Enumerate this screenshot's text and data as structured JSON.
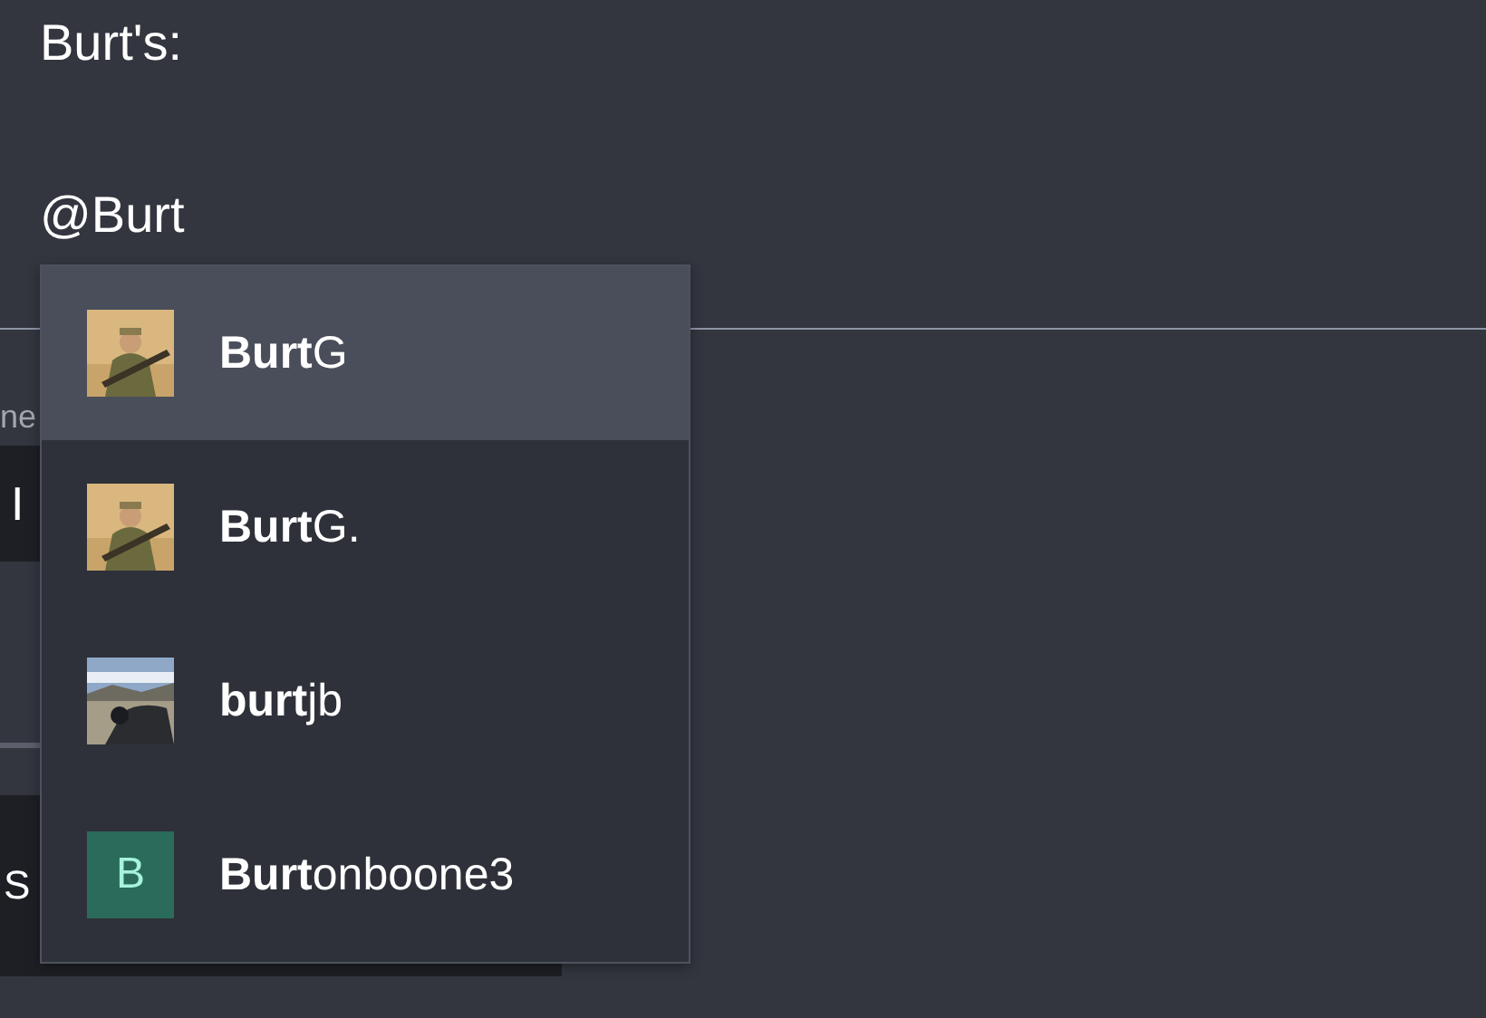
{
  "message": {
    "lines": [
      "Burt's:",
      "@Burt"
    ]
  },
  "background": {
    "heading": "ne",
    "field_1": "I",
    "field_2": "S"
  },
  "mention_menu": {
    "items": [
      {
        "name": "**Burt**G",
        "selected": true
      },
      {
        "name": "**Burt**G.",
        "selected": false
      },
      {
        "name": "**burt**jb",
        "selected": false,
        "avatar": {
          "kind": "landscape"
        }
      },
      {
        "name": "**Burt**onboone3",
        "selected": false,
        "avatar": {
          "kind": "letter",
          "letter": "B",
          "color": "#2a6b5c"
        }
      }
    ]
  }
}
